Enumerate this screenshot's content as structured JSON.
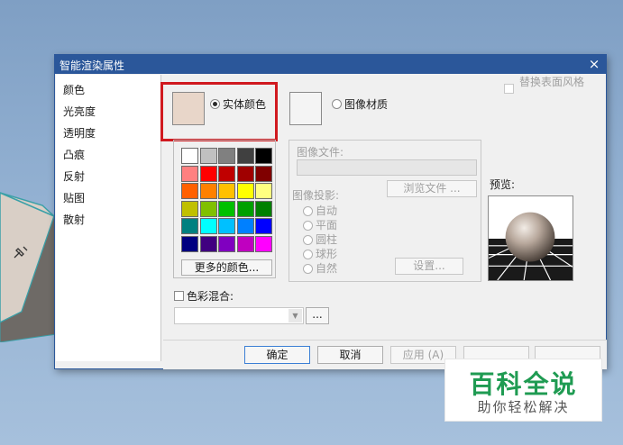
{
  "dialog": {
    "title": "智能渲染属性",
    "close_glyph": "×"
  },
  "sidebar": {
    "items": [
      {
        "label": "颜色"
      },
      {
        "label": "光亮度"
      },
      {
        "label": "透明度"
      },
      {
        "label": "凸痕"
      },
      {
        "label": "反射"
      },
      {
        "label": "贴图"
      },
      {
        "label": "散射"
      }
    ]
  },
  "color_source": {
    "solid_color_label": "实体颜色",
    "solid_color_selected": true,
    "solid_color_swatch": "#e8d6c9",
    "image_material_label": "图像材质",
    "image_material_selected": false
  },
  "replace_surface_style": {
    "label": "替换表面风格",
    "checked": false,
    "enabled": false
  },
  "palette": {
    "colors": [
      "#ffffff",
      "#c0c0c0",
      "#808080",
      "#404040",
      "#000000",
      "#ff8080",
      "#ff0000",
      "#c00000",
      "#a00000",
      "#800000",
      "#ff6000",
      "#ff8000",
      "#ffc000",
      "#ffff00",
      "#ffff80",
      "#c0c000",
      "#80c000",
      "#00c000",
      "#00a000",
      "#008000",
      "#008080",
      "#00ffff",
      "#00c0ff",
      "#0080ff",
      "#0000ff",
      "#000080",
      "#400080",
      "#8000c0",
      "#c000c0",
      "#ff00ff"
    ],
    "more_colors_label": "更多的颜色..."
  },
  "image": {
    "file_label": "图像文件:",
    "file_value": "",
    "browse_label": "浏览文件 ...",
    "projection_label": "图像投影:",
    "projection_options": [
      {
        "label": "自动",
        "selected": false
      },
      {
        "label": "平面",
        "selected": false
      },
      {
        "label": "圆柱",
        "selected": false
      },
      {
        "label": "球形",
        "selected": false
      },
      {
        "label": "自然",
        "selected": false
      }
    ],
    "settings_label": "设置..."
  },
  "preview": {
    "label": "预览:"
  },
  "color_blend": {
    "label": "色彩混合:",
    "checked": false,
    "select_value": "",
    "more_button": "..."
  },
  "footer": {
    "ok": "确定",
    "cancel": "取消",
    "apply": "应用 (A)"
  },
  "watermark": {
    "title": "百科全说",
    "subtitle": "助你轻松解决"
  },
  "colors": {
    "titlebar": "#2b579a",
    "highlight_box": "#d0191f",
    "watermark_green": "#1f9b52"
  }
}
